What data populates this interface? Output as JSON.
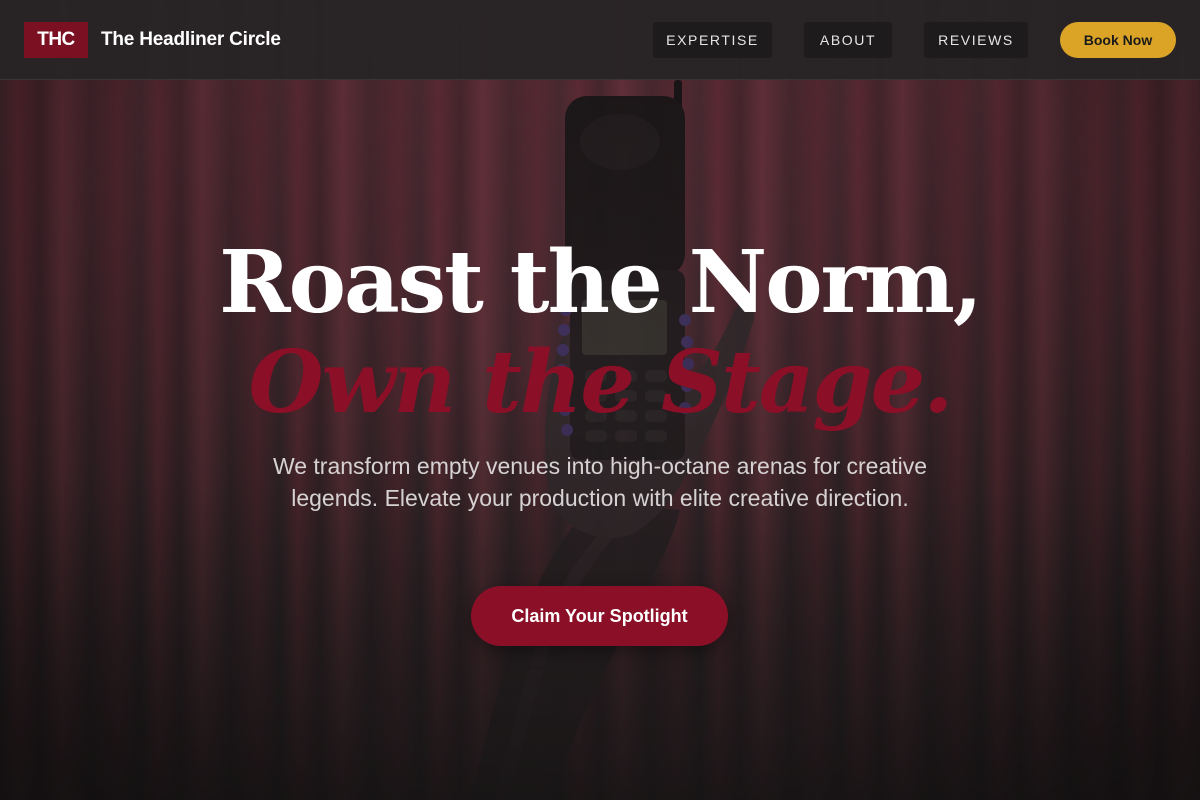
{
  "nav": {
    "logo_text": "THC",
    "brand_name": "The Headliner Circle",
    "links": [
      "EXPERTISE",
      "ABOUT",
      "REVIEWS"
    ],
    "book_label": "Book Now"
  },
  "hero": {
    "headline_line1": "Roast the Norm,",
    "headline_line2": "Own the Stage.",
    "subtext": "We transform empty venues into high-octane arenas for creative legends. Elevate your production with elite creative direction.",
    "cta_label": "Claim Your Spotlight",
    "background_image": "hand-holding-flip-phone-in-front-of-red-curtain"
  },
  "colors": {
    "accent_red": "#8b0f26",
    "logo_red": "#7a1022",
    "gold": "#dba427",
    "nav_bg": "#2a2627",
    "page_bg": "#221e1f"
  }
}
